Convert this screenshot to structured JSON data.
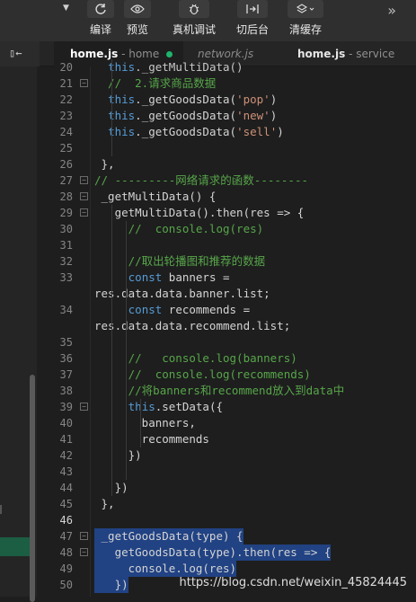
{
  "toolbar": {
    "compile_label": "编译",
    "preview_label": "预览",
    "device_debug_label": "真机调试",
    "background_label": "切后台",
    "clear_cache_label": "清缓存",
    "more": "»",
    "caret": "▼"
  },
  "tabs": [
    {
      "file": "home.js",
      "sep": " - ",
      "context": "home",
      "modified": true,
      "active": true
    },
    {
      "file": "network.js",
      "sep": "",
      "context": "",
      "modified": false,
      "active": false
    },
    {
      "file": "home.js",
      "sep": " - ",
      "context": "service",
      "modified": false,
      "active": false
    }
  ],
  "side_icon": "▯←",
  "code_lines": [
    {
      "n": "20",
      "text": "  this._getMultiData()",
      "color": "#c8c8c8",
      "fold": ""
    },
    {
      "n": "21",
      "text": "  //  2.请求商品数据",
      "color": "#57a64a",
      "fold": "−"
    },
    {
      "n": "22",
      "text": "  this._getGoodsData('pop')",
      "color": "#d4d4d4",
      "fold": ""
    },
    {
      "n": "23",
      "text": "  this._getGoodsData('new')",
      "color": "#d4d4d4",
      "fold": ""
    },
    {
      "n": "24",
      "text": "  this._getGoodsData('sell')",
      "color": "#d4d4d4",
      "fold": ""
    },
    {
      "n": "25",
      "text": "",
      "color": "#d4d4d4",
      "fold": ""
    },
    {
      "n": "26",
      "text": " },",
      "color": "#d4d4d4",
      "fold": ""
    },
    {
      "n": "27",
      "text": "// ---------网络请求的函数--------",
      "color": "#57a64a",
      "fold": "−"
    },
    {
      "n": "28",
      "text": " _getMultiData() {",
      "color": "#d4d4d4",
      "fold": "−"
    },
    {
      "n": "29",
      "text": "   getMultiData().then(res => {",
      "color": "#d4d4d4",
      "fold": "−"
    },
    {
      "n": "30",
      "text": "     //  console.log(res)",
      "color": "#57a64a",
      "fold": ""
    },
    {
      "n": "31",
      "text": "",
      "color": "#d4d4d4",
      "fold": ""
    },
    {
      "n": "32",
      "text": "     //取出轮播图和推荐的数据",
      "color": "#57a64a",
      "fold": ""
    },
    {
      "n": "33",
      "text": "     const banners =",
      "color": "#d4d4d4",
      "fold": ""
    },
    {
      "n": "",
      "text": "res.data.data.banner.list;",
      "color": "#d4d4d4",
      "fold": "",
      "wrap": true
    },
    {
      "n": "34",
      "text": "     const recommends =",
      "color": "#d4d4d4",
      "fold": ""
    },
    {
      "n": "",
      "text": "res.data.data.recommend.list;",
      "color": "#d4d4d4",
      "fold": "",
      "wrap": true
    },
    {
      "n": "35",
      "text": "",
      "color": "#d4d4d4",
      "fold": ""
    },
    {
      "n": "36",
      "text": "     //   console.log(banners)",
      "color": "#57a64a",
      "fold": ""
    },
    {
      "n": "37",
      "text": "     //  console.log(recommends)",
      "color": "#57a64a",
      "fold": ""
    },
    {
      "n": "38",
      "text": "     //将banners和recommend放入到data中",
      "color": "#57a64a",
      "fold": ""
    },
    {
      "n": "39",
      "text": "     this.setData({",
      "color": "#d4d4d4",
      "fold": "−"
    },
    {
      "n": "40",
      "text": "       banners,",
      "color": "#d4d4d4",
      "fold": ""
    },
    {
      "n": "41",
      "text": "       recommends",
      "color": "#d4d4d4",
      "fold": ""
    },
    {
      "n": "42",
      "text": "     })",
      "color": "#d4d4d4",
      "fold": ""
    },
    {
      "n": "43",
      "text": "",
      "color": "#d4d4d4",
      "fold": ""
    },
    {
      "n": "44",
      "text": "   })",
      "color": "#d4d4d4",
      "fold": ""
    },
    {
      "n": "45",
      "text": " },",
      "color": "#d4d4d4",
      "fold": ""
    },
    {
      "n": "46",
      "text": "",
      "color": "#d4d4d4",
      "fold": "",
      "sel": true,
      "current": true
    },
    {
      "n": "47",
      "text": " _getGoodsData(type) {",
      "color": "#d4d4d4",
      "fold": "−",
      "sel": true
    },
    {
      "n": "48",
      "text": "   getGoodsData(type).then(res => {",
      "color": "#d4d4d4",
      "fold": "−",
      "sel": true
    },
    {
      "n": "49",
      "text": "     console.log(res)",
      "color": "#d4d4d4",
      "fold": "",
      "sel": true
    },
    {
      "n": "50",
      "text": "   })",
      "color": "#d4d4d4",
      "fold": "",
      "sel": true
    }
  ],
  "watermark": "https://blog.csdn.net/weixin_45824445"
}
